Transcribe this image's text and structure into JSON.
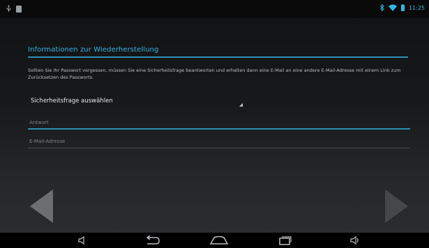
{
  "status_bar": {
    "left_icons": [
      "usb-icon",
      "sdcard-icon"
    ],
    "right_icons": [
      "bluetooth-icon",
      "wifi-icon",
      "battery-icon"
    ],
    "time": "11:25"
  },
  "page": {
    "title": "Informationen zur Wiederherstellung",
    "description": "Sollten Sie Ihr Passwort vergessen, müssen Sie eine Sicherheitsfrage beantworten und erhalten dann eine E-Mail an eine andere E-Mail-Adresse mit einem Link zum Zurücksetzen des Passworts."
  },
  "form": {
    "security_question": "Sicherheitsfrage auswählen",
    "answer_placeholder": "Antwort",
    "email_placeholder": "E-Mail-Adresse"
  },
  "wizard": {
    "prev_icon": "triangle-left-icon",
    "next_icon": "triangle-right-icon"
  },
  "nav_bar": [
    "volume-down-icon",
    "back-icon",
    "home-icon",
    "recent-apps-icon",
    "volume-up-icon"
  ],
  "colors": {
    "accent": "#33b5e5",
    "accent_line": "#2f8db6"
  }
}
